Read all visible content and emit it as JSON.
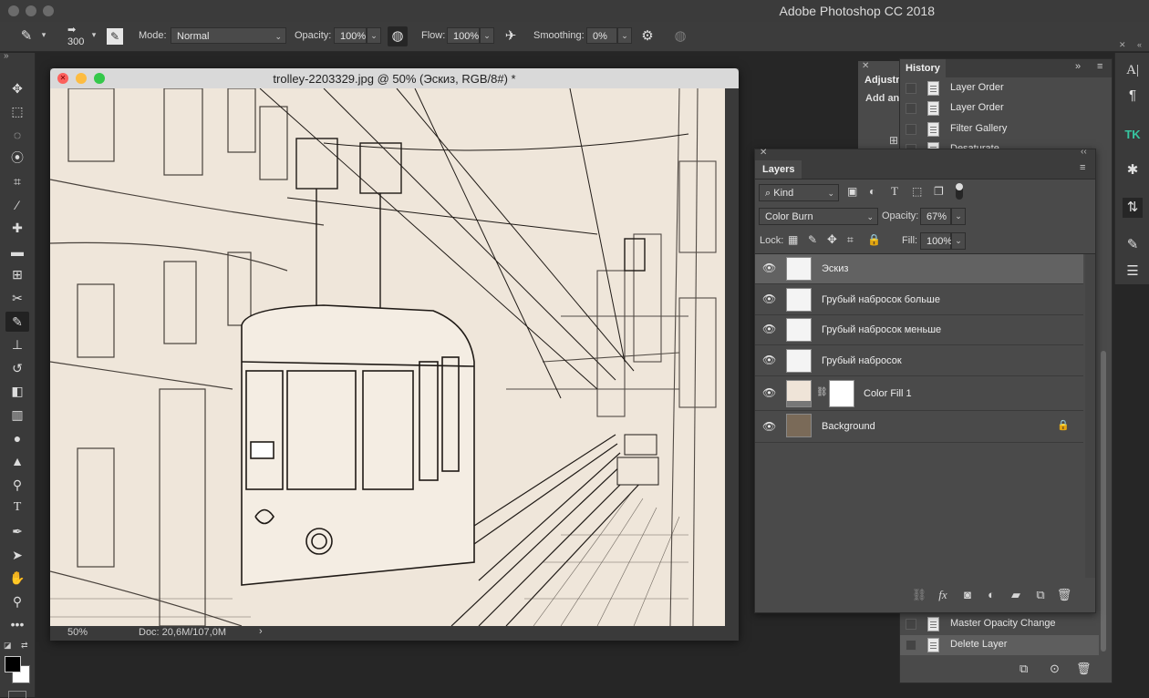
{
  "app": {
    "title": "Adobe Photoshop CC 2018"
  },
  "options": {
    "brush_size": "300",
    "mode_label": "Mode:",
    "mode_value": "Normal",
    "opacity_label": "Opacity:",
    "opacity_value": "100%",
    "flow_label": "Flow:",
    "flow_value": "100%",
    "smoothing_label": "Smoothing:",
    "smoothing_value": "0%"
  },
  "document": {
    "title": "trolley-2203329.jpg @ 50% (Эскиз, RGB/8#) *",
    "zoom": "50%",
    "doc_info": "Doc: 20,6M/107,0M"
  },
  "adjustments": {
    "tab": "Adjustm",
    "add_text": "Add an"
  },
  "history": {
    "tab": "History",
    "items": [
      {
        "label": "Layer Order"
      },
      {
        "label": "Layer Order"
      },
      {
        "label": "Filter Gallery"
      },
      {
        "label": "Desaturate"
      },
      {
        "label": "Master Opacity Change"
      },
      {
        "label": "Delete Layer"
      }
    ]
  },
  "layers": {
    "tab": "Layers",
    "kind_label": "Kind",
    "blend_mode": "Color Burn",
    "opacity_label": "Opacity:",
    "opacity_value": "67%",
    "lock_label": "Lock:",
    "fill_label": "Fill:",
    "fill_value": "100%",
    "items": [
      {
        "name": "Эскиз",
        "selected": true
      },
      {
        "name": "Грубый набросок больше",
        "selected": false
      },
      {
        "name": "Грубый набросок меньше",
        "selected": false
      },
      {
        "name": "Грубый набросок",
        "selected": false
      },
      {
        "name": "Color Fill 1",
        "selected": false
      },
      {
        "name": "Background",
        "selected": false
      }
    ]
  },
  "colors": {
    "canvas": "#efe6da",
    "panel": "#4a4a4a",
    "selected_layer": "#626262",
    "traffic_red": "#fc605c",
    "traffic_yellow": "#fdbc40",
    "traffic_green": "#34c84a"
  }
}
